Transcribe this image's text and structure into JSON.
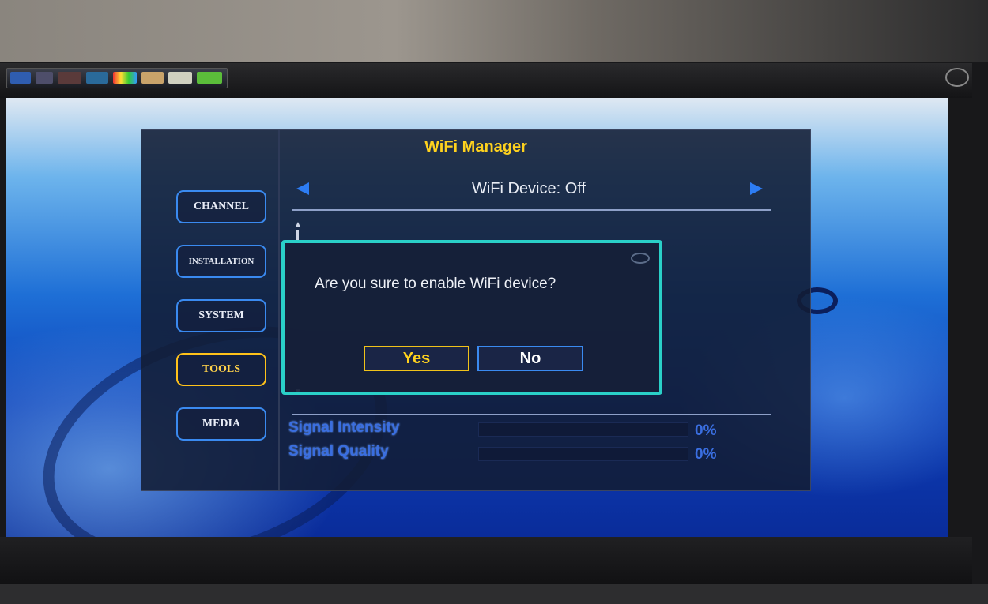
{
  "osd": {
    "title": "WiFi Manager",
    "device_row": "WiFi Device: Off",
    "menu": [
      {
        "label": "CHANNEL",
        "active": false
      },
      {
        "label": "INSTALLATION",
        "active": false
      },
      {
        "label": "SYSTEM",
        "active": false
      },
      {
        "label": "TOOLS",
        "active": true
      },
      {
        "label": "MEDIA",
        "active": false
      }
    ],
    "signal": {
      "intensity_label": "Signal Intensity",
      "intensity_value": "0%",
      "quality_label": "Signal Quality",
      "quality_value": "0%"
    }
  },
  "dialog": {
    "message": "Are you sure to enable WiFi device?",
    "yes_label": "Yes",
    "no_label": "No",
    "selected": "Yes"
  },
  "colors": {
    "title": "#ffd21e",
    "active_border": "#ffc21a",
    "button_border": "#3a8af0",
    "dialog_border": "#2ad0c8",
    "signal_text": "#3a6ee0"
  },
  "icons": {
    "left": "left-arrow-icon",
    "right": "right-arrow-icon"
  }
}
